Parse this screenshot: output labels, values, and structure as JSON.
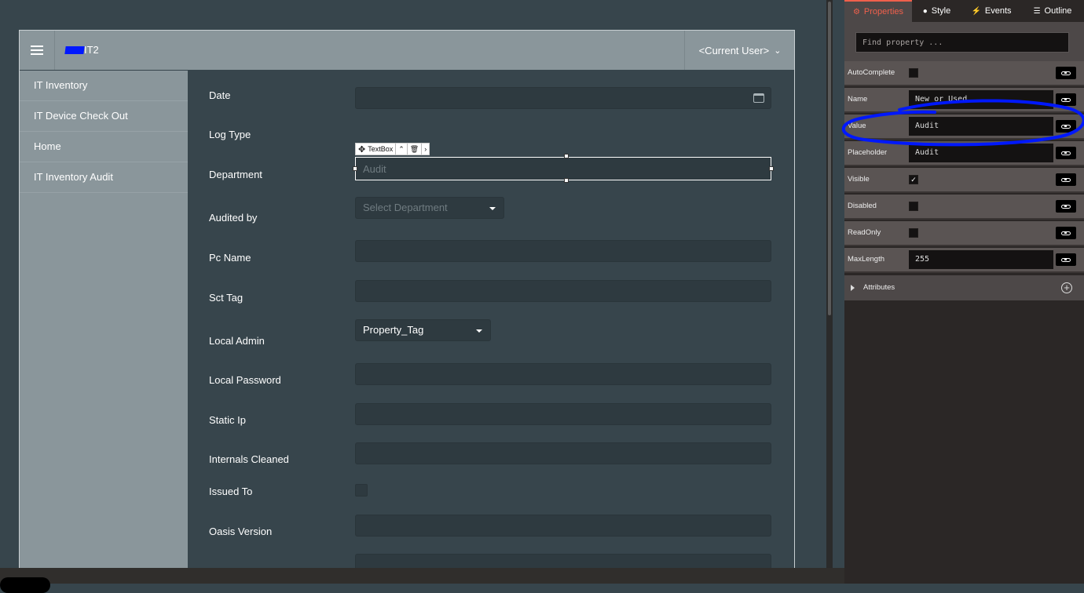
{
  "header": {
    "brand": "IT2",
    "user_menu": "<Current User>"
  },
  "sidebar": {
    "items": [
      {
        "label": "IT Inventory"
      },
      {
        "label": "IT Device Check Out"
      },
      {
        "label": "Home"
      },
      {
        "label": "IT Inventory Audit"
      }
    ]
  },
  "form": {
    "labels": {
      "date": "Date",
      "log_type": "Log Type",
      "department": "Department",
      "audited_by": "Audited by",
      "pc_name": "Pc Name",
      "sct_tag": "Sct Tag",
      "local_admin": "Local Admin",
      "local_password": "Local Password",
      "static_ip": "Static Ip",
      "internals_cleaned": "Internals Cleaned",
      "issued_to": "Issued To",
      "oasis_version": "Oasis Version"
    },
    "log_type_placeholder": "Audit",
    "department_placeholder": "Select Department",
    "sct_tag_value": "Property_Tag",
    "selection_toolbar": {
      "component_label": "TextBox"
    }
  },
  "panel": {
    "tabs": [
      {
        "label": "Properties",
        "icon": "gear-icon"
      },
      {
        "label": "Style",
        "icon": "palette-icon"
      },
      {
        "label": "Events",
        "icon": "lightning-icon"
      },
      {
        "label": "Outline",
        "icon": "outline-icon"
      }
    ],
    "search_placeholder": "Find property ...",
    "properties": {
      "autocomplete": {
        "label": "AutoComplete",
        "checked": false
      },
      "name": {
        "label": "Name",
        "value": "New_or_Used"
      },
      "value": {
        "label": "Value",
        "value": "Audit"
      },
      "placeholder": {
        "label": "Placeholder",
        "value": "Audit"
      },
      "visible": {
        "label": "Visible",
        "checked": true
      },
      "disabled": {
        "label": "Disabled",
        "checked": false
      },
      "readonly": {
        "label": "ReadOnly",
        "checked": false
      },
      "maxlength": {
        "label": "MaxLength",
        "value": "255"
      }
    },
    "attributes_label": "Attributes"
  },
  "colors": {
    "accent_tab": "#f0604c",
    "annotation": "#0018ff",
    "form_bg": "#37454c",
    "header_bg": "#8a969b"
  }
}
